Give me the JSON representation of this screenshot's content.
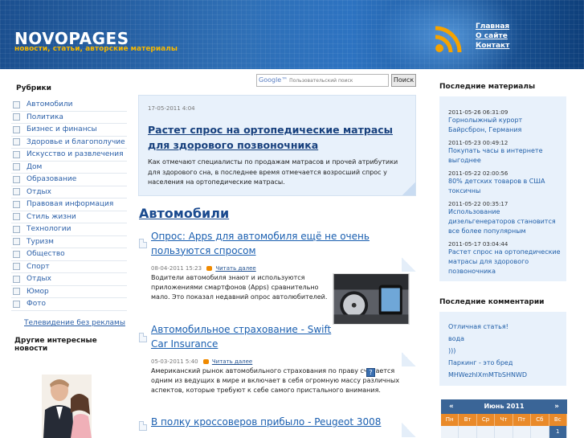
{
  "header": {
    "logo": "NOVOPAGES",
    "tagline": "новости, статьи, авторские материалы",
    "nav": [
      "Главная",
      "О сайте",
      "Контакт"
    ]
  },
  "left": {
    "rubrics_title": "Рубрики",
    "categories": [
      "Автомобили",
      "Политика",
      "Бизнес и финансы",
      "Здоровье и благополучие",
      "Искусство и развлечения",
      "Дом",
      "Образование",
      "Отдых",
      "Правовая информация",
      "Стиль жизни",
      "Технологии",
      "Туризм",
      "Общество",
      "Спорт",
      "Отдых",
      "Юмор",
      "Фото"
    ],
    "tv_link": "Телевидение без рекламы",
    "other_news_title": "Другие интересные новости"
  },
  "search": {
    "google_label": "Google™",
    "placeholder": "Пользовательский поиск",
    "button": "Поиск"
  },
  "featured": {
    "date": "17-05-2011 4:04",
    "title": "Растет спрос на ортопедические матрасы для здорового позвоночника",
    "text": "Как отмечают специалисты по продажам матрасов и прочей атрибутики для здорового сна, в последнее время отмечается возросший спрос у населения на ортопедические матрасы."
  },
  "section_title": "Автомобили",
  "articles": [
    {
      "title": "Опрос: Apps для автомобиля ещё не очень пользуются спросом",
      "date": "08-04-2011 15:23",
      "read_more": "Читать далее",
      "text": "Водители автомобиля знают и используются приложениями смартфонов (Apps) сравнительно мало. Это показал недавний опрос автолюбителей."
    },
    {
      "title": "Автомобильное страхование - Swift Car Insurance",
      "date": "05-03-2011 5:40",
      "read_more": "Читать далее",
      "text": "Американский рынок автомобильного страхования по праву считается одним из ведущих в мире и включает в себя огромную массу различных аспектов, которые требуют к себе самого пристального внимания."
    },
    {
      "title": "В полку кроссоверов прибыло - Peugeot 3008"
    }
  ],
  "question_icon": "?",
  "right": {
    "recent_title": "Последние материалы",
    "recent": [
      {
        "date": "2011-05-26 06:31:09",
        "title": "Горнолыжный курорт Байрсброн, Германия"
      },
      {
        "date": "2011-05-23 00:49:12",
        "title": "Покупать часы в интернете выгоднее"
      },
      {
        "date": "2011-05-22 02:00:56",
        "title": "80% детских товаров в США токсичны"
      },
      {
        "date": "2011-05-22 00:35:17",
        "title": "Использование дизельгенераторов становится все более популярным"
      },
      {
        "date": "2011-05-17 03:04:44",
        "title": "Растет спрос на ортопедические матрасы для здорового позвоночника"
      }
    ],
    "comments_title": "Последние комментарии",
    "comments": [
      "Отличная статья!",
      "вода",
      ")))",
      "Паркинг - это бред",
      "MHWezhlXmMTbSHNWD"
    ]
  },
  "calendar": {
    "prev": "«",
    "month": "Июнь 2011",
    "next": "»",
    "days": [
      "Пн",
      "Вт",
      "Ср",
      "Чт",
      "Пт",
      "Сб",
      "Вс"
    ],
    "first_row_last": "1"
  },
  "colors": {
    "header_blue": "#2f6fb5",
    "tagline_gold": "#f5b700",
    "link_blue": "#1a5fb0",
    "panel_bg": "#e8f1fb",
    "calendar_orange": "#e98a2a"
  }
}
